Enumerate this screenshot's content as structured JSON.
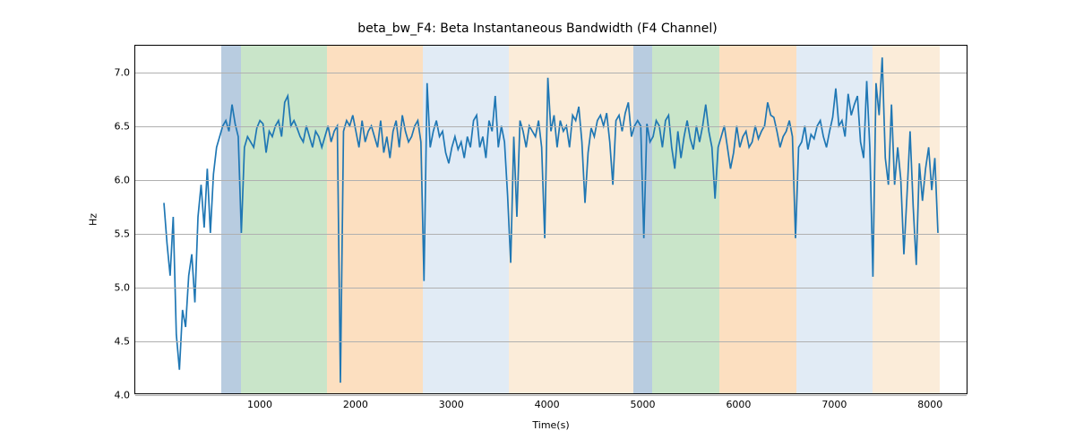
{
  "chart_data": {
    "type": "line",
    "title": "beta_bw_F4: Beta Instantaneous Bandwidth (F4 Channel)",
    "xlabel": "Time(s)",
    "ylabel": "Hz",
    "xlim": [
      -300,
      8400
    ],
    "ylim": [
      4.0,
      7.25
    ],
    "yticks": [
      4.0,
      4.5,
      5.0,
      5.5,
      6.0,
      6.5,
      7.0
    ],
    "xticks": [
      1000,
      2000,
      3000,
      4000,
      5000,
      6000,
      7000,
      8000
    ],
    "grid": true,
    "shaded_regions": [
      {
        "x0": 600,
        "x1": 800,
        "color": "#b8cce0"
      },
      {
        "x0": 800,
        "x1": 1700,
        "color": "#c9e5c9"
      },
      {
        "x0": 1700,
        "x1": 2700,
        "color": "#fcdfc0"
      },
      {
        "x0": 2700,
        "x1": 3600,
        "color": "#e1ebf5"
      },
      {
        "x0": 3600,
        "x1": 4900,
        "color": "#fbecd9"
      },
      {
        "x0": 4900,
        "x1": 5100,
        "color": "#b8cce0"
      },
      {
        "x0": 5100,
        "x1": 5800,
        "color": "#c9e5c9"
      },
      {
        "x0": 5800,
        "x1": 6600,
        "color": "#fcdfc0"
      },
      {
        "x0": 6600,
        "x1": 7400,
        "color": "#e1ebf5"
      },
      {
        "x0": 7400,
        "x1": 8100,
        "color": "#fbecd9"
      }
    ],
    "x": [
      0,
      32.4,
      64.8,
      97.2,
      129.6,
      162,
      194.4,
      226.8,
      259.2,
      291.6,
      324,
      356.4,
      388.8,
      421.2,
      453.6,
      486,
      518.4,
      550.8,
      583.2,
      615.6,
      648,
      680.4,
      712.8,
      745.2,
      777.6,
      810,
      842.4,
      874.8,
      907.2,
      939.6,
      972,
      1004.4,
      1036.8,
      1069.2,
      1101.6,
      1134,
      1166.4,
      1198.8,
      1231.2,
      1263.6,
      1296,
      1328.4,
      1360.8,
      1393.2,
      1425.6,
      1458,
      1490.4,
      1522.8,
      1555.2,
      1587.6,
      1620,
      1652.4,
      1684.8,
      1717.2,
      1749.6,
      1782,
      1814.4,
      1846.8,
      1879.2,
      1911.6,
      1944,
      1976.4,
      2008.8,
      2041.2,
      2073.6,
      2106,
      2138.4,
      2170.8,
      2203.2,
      2235.6,
      2268,
      2300.4,
      2332.8,
      2365.2,
      2397.6,
      2430,
      2462.4,
      2494.8,
      2527.2,
      2559.6,
      2592,
      2624.4,
      2656.8,
      2689.2,
      2721.6,
      2754,
      2786.4,
      2818.8,
      2851.2,
      2883.6,
      2916,
      2948.4,
      2980.8,
      3013.2,
      3045.6,
      3078,
      3110.4,
      3142.8,
      3175.2,
      3207.6,
      3240,
      3272.4,
      3304.8,
      3337.2,
      3369.6,
      3402,
      3434.4,
      3466.8,
      3499.2,
      3531.6,
      3564,
      3596.4,
      3628.8,
      3661.2,
      3693.6,
      3726,
      3758.4,
      3790.8,
      3823.2,
      3855.6,
      3888,
      3920.4,
      3952.8,
      3985.2,
      4017.6,
      4050,
      4082.4,
      4114.8,
      4147.2,
      4179.6,
      4212,
      4244.4,
      4276.8,
      4309.2,
      4341.6,
      4374,
      4406.4,
      4438.8,
      4471.2,
      4503.6,
      4536,
      4568.4,
      4600.8,
      4633.2,
      4665.6,
      4698,
      4730.4,
      4762.8,
      4795.2,
      4827.6,
      4860,
      4892.4,
      4924.8,
      4957.2,
      4989.6,
      5022,
      5054.4,
      5086.8,
      5119.2,
      5151.6,
      5184,
      5216.4,
      5248.8,
      5281.2,
      5313.6,
      5346,
      5378.4,
      5410.8,
      5443.2,
      5475.6,
      5508,
      5540.4,
      5572.8,
      5605.2,
      5637.6,
      5670,
      5702.4,
      5734.8,
      5767.2,
      5799.6,
      5832,
      5864.4,
      5896.8,
      5929.2,
      5961.6,
      5994,
      6026.4,
      6058.8,
      6091.2,
      6123.6,
      6156,
      6188.4,
      6220.8,
      6253.2,
      6285.6,
      6318,
      6350.4,
      6382.8,
      6415.2,
      6447.6,
      6480,
      6512.4,
      6544.8,
      6577.2,
      6609.6,
      6642,
      6674.4,
      6706.8,
      6739.2,
      6771.6,
      6804,
      6836.4,
      6868.8,
      6901.2,
      6933.6,
      6966,
      6998.4,
      7030.8,
      7063.2,
      7095.6,
      7128,
      7160.4,
      7192.8,
      7225.2,
      7257.6,
      7290,
      7322.4,
      7354.8,
      7387.2,
      7419.6,
      7452,
      7484.4,
      7516.8,
      7549.2,
      7581.6,
      7614,
      7646.4,
      7678.8,
      7711.2,
      7743.6,
      7776,
      7808.4,
      7840.8,
      7873.2,
      7905.6,
      7938,
      7970.4,
      8002.8,
      8035.2,
      8067.6,
      8100
    ],
    "values": [
      5.78,
      5.4,
      5.1,
      5.65,
      4.55,
      4.22,
      4.78,
      4.62,
      5.1,
      5.3,
      4.85,
      5.65,
      5.95,
      5.55,
      6.1,
      5.5,
      6.05,
      6.3,
      6.4,
      6.5,
      6.55,
      6.45,
      6.7,
      6.52,
      6.4,
      5.5,
      6.3,
      6.4,
      6.35,
      6.3,
      6.48,
      6.55,
      6.52,
      6.25,
      6.45,
      6.4,
      6.5,
      6.55,
      6.4,
      6.72,
      6.78,
      6.5,
      6.55,
      6.48,
      6.4,
      6.35,
      6.5,
      6.4,
      6.3,
      6.45,
      6.4,
      6.3,
      6.4,
      6.5,
      6.35,
      6.45,
      6.5,
      4.1,
      6.45,
      6.55,
      6.5,
      6.6,
      6.45,
      6.3,
      6.55,
      6.35,
      6.45,
      6.5,
      6.4,
      6.3,
      6.55,
      6.25,
      6.4,
      6.2,
      6.45,
      6.55,
      6.3,
      6.6,
      6.45,
      6.35,
      6.4,
      6.5,
      6.55,
      6.35,
      5.05,
      6.9,
      6.3,
      6.45,
      6.55,
      6.4,
      6.45,
      6.25,
      6.15,
      6.3,
      6.4,
      6.28,
      6.35,
      6.2,
      6.4,
      6.3,
      6.55,
      6.6,
      6.3,
      6.4,
      6.2,
      6.55,
      6.45,
      6.78,
      6.3,
      6.5,
      6.35,
      5.85,
      5.22,
      6.4,
      5.65,
      6.55,
      6.45,
      6.3,
      6.5,
      6.45,
      6.4,
      6.55,
      6.3,
      5.45,
      6.95,
      6.45,
      6.6,
      6.3,
      6.55,
      6.45,
      6.5,
      6.3,
      6.6,
      6.55,
      6.68,
      6.35,
      5.78,
      6.25,
      6.48,
      6.4,
      6.55,
      6.6,
      6.5,
      6.62,
      6.35,
      5.95,
      6.55,
      6.6,
      6.45,
      6.62,
      6.72,
      6.4,
      6.5,
      6.55,
      6.5,
      5.45,
      6.52,
      6.35,
      6.4,
      6.55,
      6.5,
      6.3,
      6.55,
      6.6,
      6.3,
      6.1,
      6.45,
      6.2,
      6.4,
      6.55,
      6.38,
      6.28,
      6.5,
      6.35,
      6.5,
      6.7,
      6.45,
      6.3,
      5.82,
      6.3,
      6.4,
      6.5,
      6.3,
      6.1,
      6.25,
      6.5,
      6.3,
      6.4,
      6.45,
      6.3,
      6.35,
      6.5,
      6.38,
      6.45,
      6.5,
      6.72,
      6.6,
      6.58,
      6.45,
      6.3,
      6.4,
      6.45,
      6.55,
      6.4,
      5.45,
      6.3,
      6.35,
      6.5,
      6.28,
      6.42,
      6.38,
      6.5,
      6.55,
      6.4,
      6.3,
      6.45,
      6.58,
      6.85,
      6.5,
      6.55,
      6.4,
      6.8,
      6.6,
      6.7,
      6.78,
      6.35,
      6.2,
      6.92,
      6.3,
      5.09,
      6.9,
      6.6,
      7.14,
      6.2,
      5.95,
      6.7,
      5.95,
      6.3,
      6.0,
      5.3,
      5.85,
      6.45,
      5.75,
      5.2,
      6.15,
      5.8,
      6.1,
      6.3,
      5.9,
      6.2,
      5.5
    ]
  }
}
